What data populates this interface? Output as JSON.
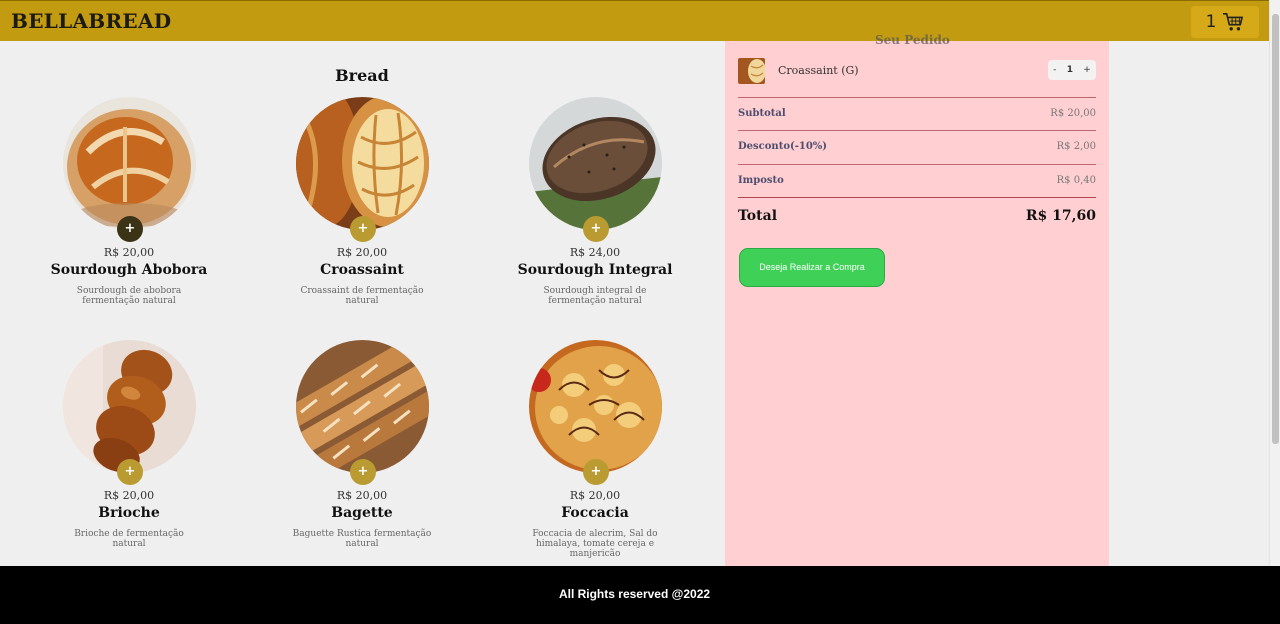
{
  "header": {
    "brand": "BELLABREAD",
    "cart_count": "1",
    "cart_icon": "cart-icon",
    "colors": {
      "bar": "#c29b10",
      "cart_button": "#d6a918"
    }
  },
  "catalog": {
    "title": "Bread",
    "add_symbol": "+",
    "products": [
      {
        "price": "R$ 20,00",
        "name": "Sourdough Abobora",
        "description": "Sourdough de abobora fermentação natural",
        "button_color": "#3a3316"
      },
      {
        "price": "R$ 20,00",
        "name": "Croassaint",
        "description": "Croassaint de fermentação natural",
        "button_color": "#b99b32"
      },
      {
        "price": "R$ 24,00",
        "name": "Sourdough Integral",
        "description": "Sourdough integral de fermentação natural",
        "button_color": "#b99b32"
      },
      {
        "price": "R$ 20,00",
        "name": "Brioche",
        "description": "Brioche de fermentação natural",
        "button_color": "#b99b32"
      },
      {
        "price": "R$ 20,00",
        "name": "Bagette",
        "description": "Baguette Rustica fermentação natural",
        "button_color": "#b99b32"
      },
      {
        "price": "R$ 20,00",
        "name": "Foccacia",
        "description": "Foccacia de alecrim, Sal do himalaya, tomate cereja e manjericão",
        "button_color": "#b99b32"
      }
    ]
  },
  "cart": {
    "heading_fragment": "Seu Pedido",
    "item": {
      "name": "Croassaint (G)",
      "minus": "-",
      "quantity": "1",
      "plus": "+"
    },
    "subtotal_label": "Subtotal",
    "subtotal_value": "R$ 20,00",
    "discount_label": "Desconto(-10%)",
    "discount_value": "R$ 2,00",
    "tax_label": "Imposto",
    "tax_value": "R$ 0,40",
    "total_label": "Total",
    "total_value": "R$ 17,60",
    "checkout_label": "Deseja Realizar a Compra",
    "colors": {
      "panel": "#ffcfd2",
      "checkout": "#3fd058"
    }
  },
  "footer": {
    "text": "All Rights reserved @2022"
  }
}
